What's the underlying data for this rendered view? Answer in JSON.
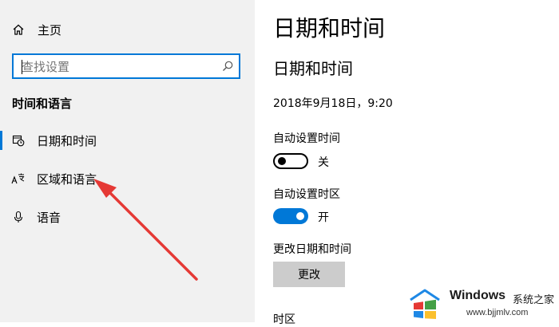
{
  "sidebar": {
    "home": {
      "label": "主页",
      "icon": "home-icon"
    },
    "search": {
      "placeholder": "查找设置",
      "value": "",
      "icon": "search-icon"
    },
    "section_heading": "时间和语言",
    "items": [
      {
        "label": "日期和时间",
        "icon": "calendar-clock-icon",
        "selected": true
      },
      {
        "label": "区域和语言",
        "icon": "language-icon",
        "selected": false
      },
      {
        "label": "语音",
        "icon": "microphone-icon",
        "selected": false
      }
    ]
  },
  "main": {
    "page_title": "日期和时间",
    "sub_title": "日期和时间",
    "current_datetime": "2018年9月18日，9:20",
    "auto_time": {
      "label": "自动设置时间",
      "state_text": "关",
      "on": false
    },
    "auto_timezone": {
      "label": "自动设置时区",
      "state_text": "开",
      "on": true
    },
    "change_datetime": {
      "label": "更改日期和时间",
      "button_label": "更改"
    },
    "timezone_label": "时区"
  },
  "watermark": {
    "title": "Windows",
    "suffix": "系统之家",
    "url": "www.bjjmlv.com"
  },
  "colors": {
    "accent": "#0078d7",
    "sidebar_bg": "#f1f1f1",
    "button_bg": "#cccccc",
    "annotation_arrow": "#e53935"
  }
}
